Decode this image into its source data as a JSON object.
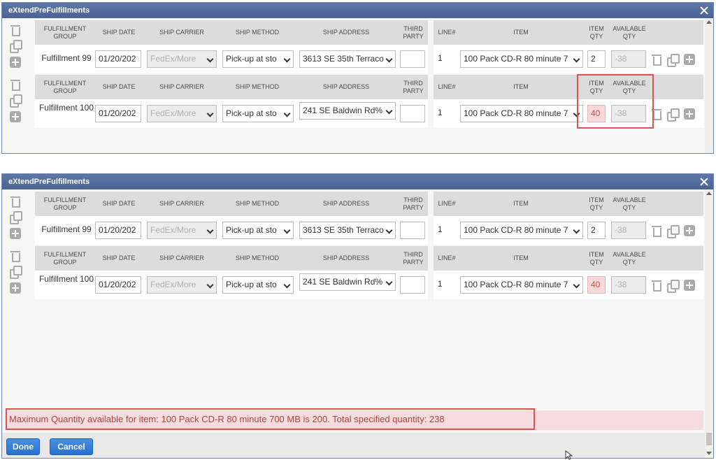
{
  "top_dialog": {
    "title": "eXtendPreFulfillments",
    "groups": [
      {
        "headers": {
          "fulfillment_group": "FULFILLMENT GROUP",
          "ship_date": "SHIP DATE",
          "ship_carrier": "SHIP CARRIER",
          "ship_method": "SHIP METHOD",
          "ship_address": "SHIP ADDRESS",
          "third_party": "THIRD PARTY",
          "line": "LINE#",
          "item": "ITEM",
          "item_qty": "ITEM QTY",
          "available_qty": "AVAILABLE QTY"
        },
        "row": {
          "fulfillment_name": "Fulfillment 99",
          "ship_date": "01/20/202",
          "ship_carrier": "FedEx/More",
          "ship_method": "Pick-up at sto",
          "ship_address": "3613 SE 35th Terraco",
          "third_party": "",
          "line": "1",
          "item": "100 Pack CD-R 80 minute 7",
          "item_qty": "2",
          "available_qty": "-38"
        }
      },
      {
        "headers": {
          "fulfillment_group": "FULFILLMENT GROUP",
          "ship_date": "SHIP DATE",
          "ship_carrier": "SHIP CARRIER",
          "ship_method": "SHIP METHOD",
          "ship_address": "SHIP ADDRESS",
          "third_party": "THIRD PARTY",
          "line": "LINE#",
          "item": "ITEM",
          "item_qty": "ITEM QTY",
          "available_qty": "AVAILABLE QTY"
        },
        "row": {
          "fulfillment_name": "Fulfillment 100",
          "ship_date": "01/20/202",
          "ship_carrier": "FedEx/More",
          "ship_method": "Pick-up at sto",
          "ship_address": "241 SE Baldwin Rd%",
          "third_party": "",
          "line": "1",
          "item": "100 Pack CD-R 80 minute 7",
          "item_qty": "40",
          "available_qty": "-38"
        }
      }
    ]
  },
  "bottom_dialog": {
    "title": "eXtendPreFulfillments",
    "groups": [
      {
        "headers": {
          "fulfillment_group": "FULFILLMENT GROUP",
          "ship_date": "SHIP DATE",
          "ship_carrier": "SHIP CARRIER",
          "ship_method": "SHIP METHOD",
          "ship_address": "SHIP ADDRESS",
          "third_party": "THIRD PARTY",
          "line": "LINE#",
          "item": "ITEM",
          "item_qty": "ITEM QTY",
          "available_qty": "AVAILABLE QTY"
        },
        "row": {
          "fulfillment_name": "Fulfillment 99",
          "ship_date": "01/20/202",
          "ship_carrier": "FedEx/More",
          "ship_method": "Pick-up at sto",
          "ship_address": "3613 SE 35th Terraco",
          "third_party": "",
          "line": "1",
          "item": "100 Pack CD-R 80 minute 7",
          "item_qty": "2",
          "available_qty": "-38"
        }
      },
      {
        "headers": {
          "fulfillment_group": "FULFILLMENT GROUP",
          "ship_date": "SHIP DATE",
          "ship_carrier": "SHIP CARRIER",
          "ship_method": "SHIP METHOD",
          "ship_address": "SHIP ADDRESS",
          "third_party": "THIRD PARTY",
          "line": "LINE#",
          "item": "ITEM",
          "item_qty": "ITEM QTY",
          "available_qty": "AVAILABLE QTY"
        },
        "row": {
          "fulfillment_name": "Fulfillment 100",
          "ship_date": "01/20/202",
          "ship_carrier": "FedEx/More",
          "ship_method": "Pick-up at sto",
          "ship_address": "241 SE Baldwin Rd%",
          "third_party": "",
          "line": "1",
          "item": "100 Pack CD-R 80 minute 7",
          "item_qty": "40",
          "available_qty": "-38"
        }
      }
    ],
    "error_message": "Maximum Quantity available for item: 100 Pack CD-R 80 minute 700 MB is 200. Total specified quantity: 238",
    "buttons": {
      "done": "Done",
      "cancel": "Cancel"
    }
  },
  "icons": [
    "trash-icon",
    "copy-icon",
    "plus-icon",
    "close-icon",
    "chevron-down-icon",
    "cursor-arrow-icon"
  ],
  "colors": {
    "titlebar": "#5f77a6",
    "error_text": "#a94442",
    "error_bg": "#f6dcdc",
    "highlight": "#d9534f",
    "button": "#2a6fcf"
  }
}
